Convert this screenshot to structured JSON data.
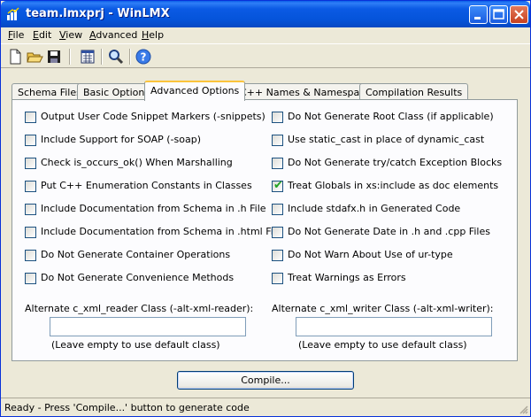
{
  "window": {
    "title": "team.lmxprj - WinLMX"
  },
  "menu": [
    {
      "label": "File",
      "u": "F",
      "rest": "ile"
    },
    {
      "label": "Edit",
      "u": "E",
      "rest": "dit"
    },
    {
      "label": "View",
      "u": "V",
      "rest": "iew"
    },
    {
      "label": "Advanced",
      "u": "A",
      "rest": "dvanced"
    },
    {
      "label": "Help",
      "u": "H",
      "rest": "elp"
    }
  ],
  "toolbar": {
    "icons": [
      "new-file-icon",
      "open-folder-icon",
      "save-icon",
      "calendar-icon",
      "search-icon",
      "help-icon"
    ]
  },
  "tabs": [
    {
      "label": "Schema Files",
      "active": false
    },
    {
      "label": "Basic Options",
      "active": false
    },
    {
      "label": "Advanced Options",
      "active": true
    },
    {
      "label": "C++ Names & Namespaces",
      "active": false
    },
    {
      "label": "Compilation Results",
      "active": false
    }
  ],
  "options_left": [
    {
      "label": "Output User Code Snippet Markers (-snippets)",
      "checked": false
    },
    {
      "label": "Include Support for SOAP (-soap)",
      "checked": false
    },
    {
      "label": "Check is_occurs_ok() When Marshalling",
      "checked": false
    },
    {
      "label": "Put C++ Enumeration Constants in Classes",
      "checked": false
    },
    {
      "label": "Include Documentation from Schema in .h File",
      "checked": false
    },
    {
      "label": "Include Documentation from Schema in .html File",
      "checked": false
    },
    {
      "label": "Do Not Generate Container Operations",
      "checked": false
    },
    {
      "label": "Do Not Generate Convenience Methods",
      "checked": false
    }
  ],
  "options_right": [
    {
      "label": "Do Not Generate Root Class (if applicable)",
      "checked": false
    },
    {
      "label": "Use static_cast in place of dynamic_cast",
      "checked": false
    },
    {
      "label": "Do Not Generate try/catch Exception Blocks",
      "checked": false
    },
    {
      "label": "Treat Globals in xs:include as doc elements",
      "checked": true
    },
    {
      "label": "Include stdafx.h in Generated Code",
      "checked": false
    },
    {
      "label": "Do Not Generate Date in .h and .cpp Files",
      "checked": false
    },
    {
      "label": "Do Not Warn About Use of ur-type",
      "checked": false
    },
    {
      "label": "Treat Warnings as Errors",
      "checked": false
    }
  ],
  "reader": {
    "label": "Alternate c_xml_reader Class (-alt-xml-reader):",
    "value": "",
    "hint": "(Leave empty to use default class)"
  },
  "writer": {
    "label": "Alternate c_xml_writer Class (-alt-xml-writer):",
    "value": "",
    "hint": "(Leave empty to use default class)"
  },
  "compile_button": "Compile...",
  "status": "Ready - Press 'Compile...' button to generate code"
}
